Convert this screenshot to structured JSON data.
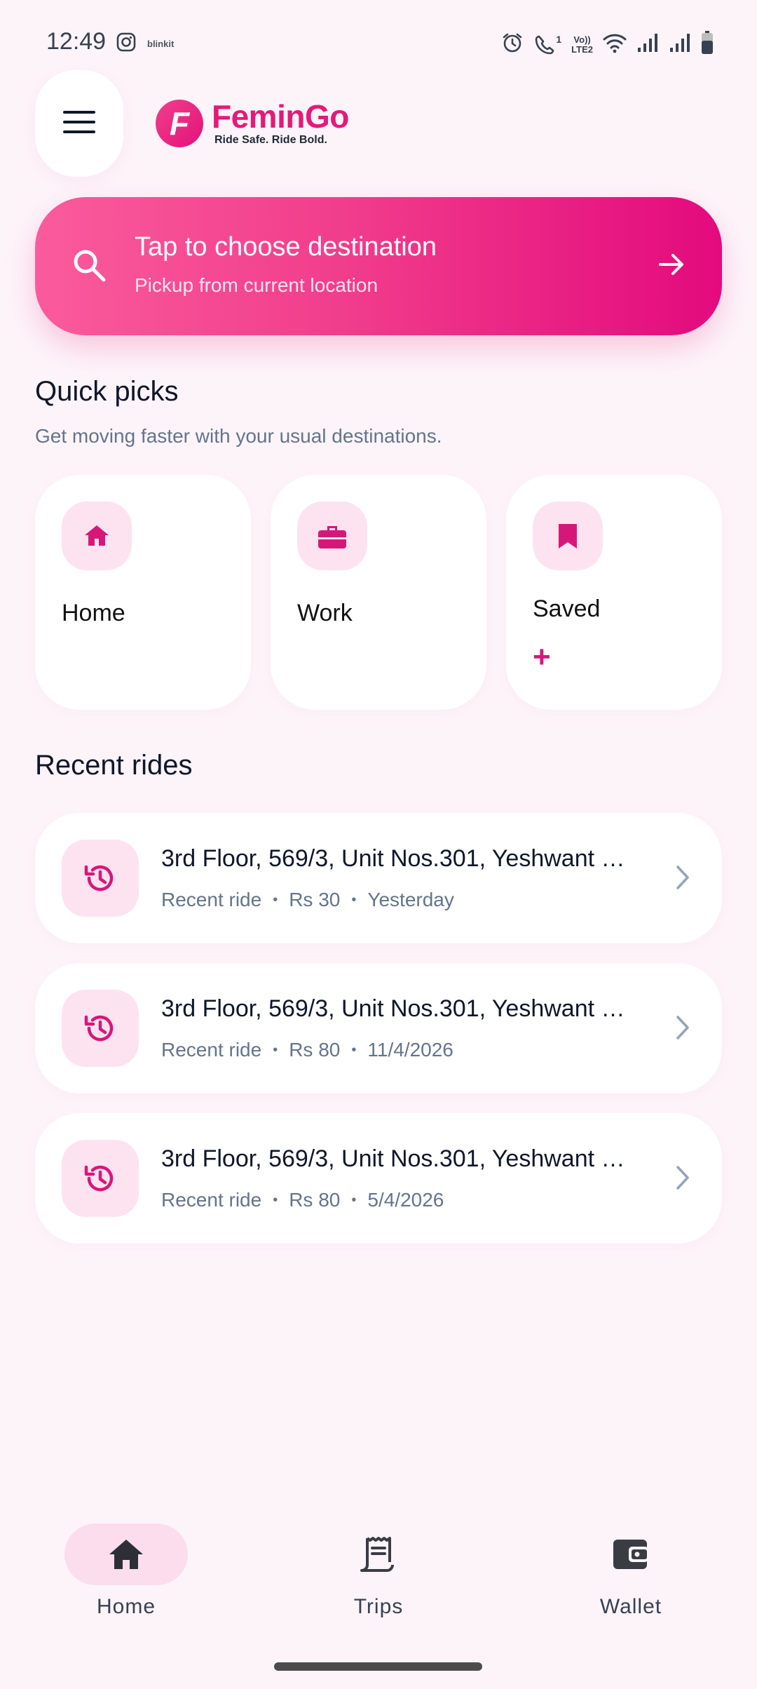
{
  "status_bar": {
    "time": "12:49",
    "blinkit": "blinkit",
    "volte": "Vo)) LTE2",
    "signal_badge": "1"
  },
  "app": {
    "name": "FeminGo",
    "tagline": "Ride Safe. Ride Bold.",
    "logo_letter": "F",
    "brand_color": "#E31A78"
  },
  "search": {
    "title": "Tap to choose destination",
    "subtitle": "Pickup from current location"
  },
  "quick_picks": {
    "title": "Quick picks",
    "subtitle": "Get moving faster with your usual destinations.",
    "items": [
      {
        "label": "Home",
        "icon": "home-icon"
      },
      {
        "label": "Work",
        "icon": "briefcase-icon"
      },
      {
        "label": "Saved",
        "icon": "bookmark-icon",
        "add": "+"
      }
    ]
  },
  "recent_rides": {
    "title": "Recent rides",
    "items": [
      {
        "address": "3rd Floor, 569/3, Unit Nos.301, Yeshwant N...",
        "type": "Recent ride",
        "price": "Rs 30",
        "date": "Yesterday"
      },
      {
        "address": "3rd Floor, 569/3, Unit Nos.301, Yeshwant N...",
        "type": "Recent ride",
        "price": "Rs 80",
        "date": "11/4/2026"
      },
      {
        "address": "3rd Floor, 569/3, Unit Nos.301, Yeshwant N...",
        "type": "Recent ride",
        "price": "Rs 80",
        "date": "5/4/2026"
      }
    ],
    "separator": "•"
  },
  "bottom_nav": {
    "items": [
      {
        "label": "Home",
        "icon": "home-icon",
        "active": true
      },
      {
        "label": "Trips",
        "icon": "receipt-icon",
        "active": false
      },
      {
        "label": "Wallet",
        "icon": "wallet-icon",
        "active": false
      }
    ]
  }
}
